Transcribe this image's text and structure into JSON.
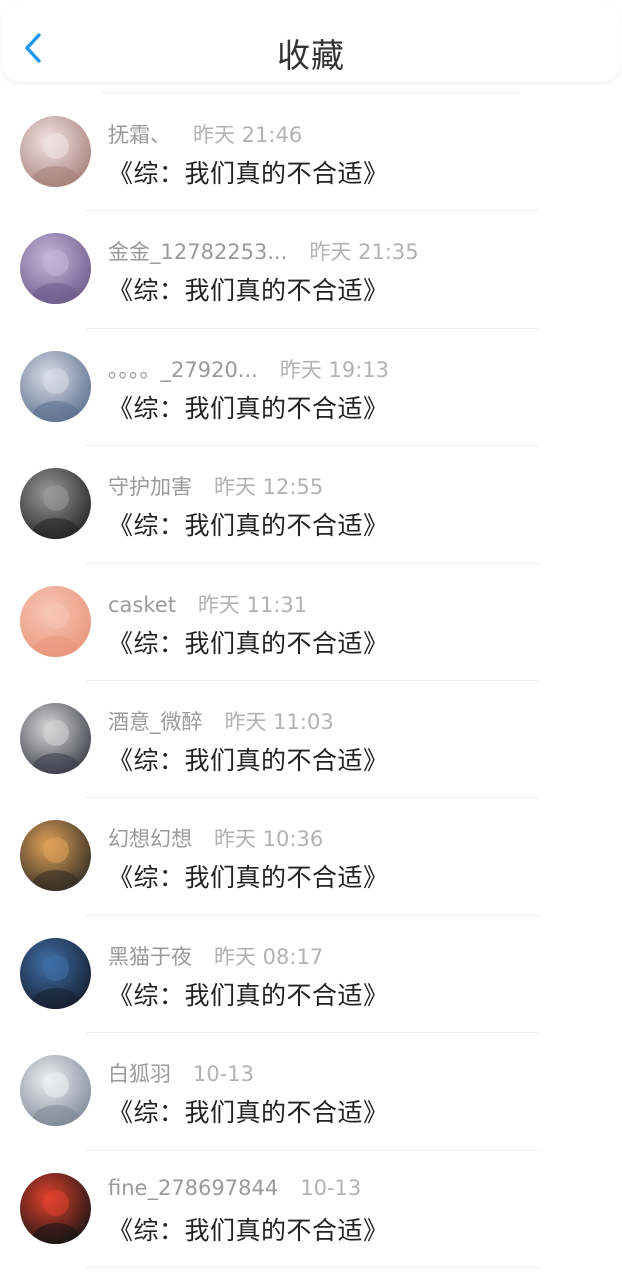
{
  "header": {
    "title": "收藏",
    "back_icon": "chevron-left-icon",
    "accent_color": "#2196f3"
  },
  "favorites": [
    {
      "name": "抚霜、",
      "time": "昨天 21:46",
      "book": "《综：我们真的不合适》",
      "avatar_colors": [
        "#f1e3e3",
        "#a58078"
      ]
    },
    {
      "name": "金金_12782253...",
      "time": "昨天 21:35",
      "book": "《综：我们真的不合适》",
      "avatar_colors": [
        "#c6b6d9",
        "#6c5a8a"
      ]
    },
    {
      "name": "。。。。_27920...",
      "time": "昨天 19:13",
      "book": "《综：我们真的不合适》",
      "avatar_colors": [
        "#d8dde6",
        "#5a6e8c"
      ]
    },
    {
      "name": "守护加害",
      "time": "昨天 12:55",
      "book": "《综：我们真的不合适》",
      "avatar_colors": [
        "#9a9a9a",
        "#222222"
      ]
    },
    {
      "name": "casket",
      "time": "昨天 11:31",
      "book": "《综：我们真的不合适》",
      "avatar_colors": [
        "#f6c7b5",
        "#e9957c"
      ]
    },
    {
      "name": "酒意_微醉",
      "time": "昨天 11:03",
      "book": "《综：我们真的不合适》",
      "avatar_colors": [
        "#d6d6d6",
        "#3b3b48"
      ]
    },
    {
      "name": "幻想幻想",
      "time": "昨天 10:36",
      "book": "《综：我们真的不合适》",
      "avatar_colors": [
        "#e0a25a",
        "#2e2a22"
      ]
    },
    {
      "name": "黑猫于夜",
      "time": "昨天 08:17",
      "book": "《综：我们真的不合适》",
      "avatar_colors": [
        "#3f6fa8",
        "#151d2c"
      ]
    },
    {
      "name": "白狐羽",
      "time": "10-13",
      "book": "《综：我们真的不合适》",
      "avatar_colors": [
        "#eef0f2",
        "#7d8796"
      ]
    },
    {
      "name": "fine_278697844",
      "time": "10-13",
      "book": "《综：我们真的不合适》",
      "avatar_colors": [
        "#e0412d",
        "#141414"
      ]
    }
  ]
}
